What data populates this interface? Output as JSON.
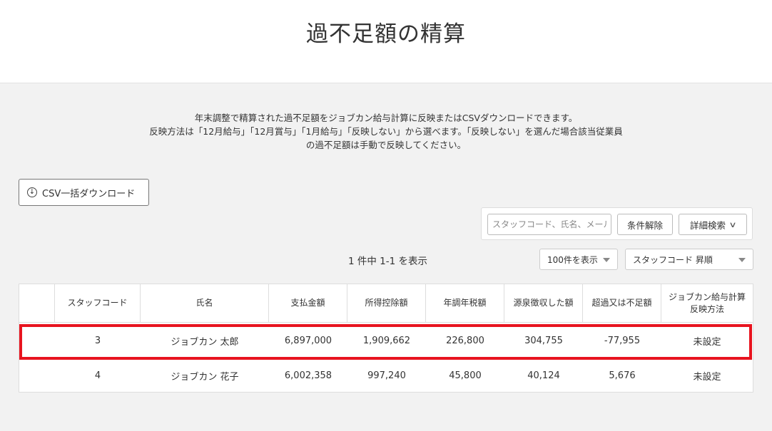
{
  "page": {
    "title": "過不足額の精算"
  },
  "description": {
    "line1": "年末調整で精算された過不足額をジョブカン給与計算に反映またはCSVダウンロードできます。",
    "line2": "反映方法は「12月給与」「12月賞与」「1月給与」「反映しない」から選べます。「反映しない」を選んだ場合該当従業員",
    "line3": "の過不足額は手動で反映してください。"
  },
  "toolbar": {
    "csv_download_label": "CSV一括ダウンロード",
    "csv_icon": "download-circle-icon"
  },
  "search": {
    "placeholder": "スタッフコード、氏名、メール",
    "clear_label": "条件解除",
    "advanced_label": "詳細検索",
    "advanced_icon": "chevron-down-icon"
  },
  "listing": {
    "count_text": "1 件中 1-1 を表示",
    "per_page": "100件を表示",
    "sort": "スタッフコード 昇順"
  },
  "table": {
    "headers": [
      "",
      "スタッフコード",
      "氏名",
      "支払金額",
      "所得控除額",
      "年調年税額",
      "源泉徴収した額",
      "超過又は不足額",
      "ジョブカン給与計算\n反映方法"
    ],
    "rows": [
      [
        "",
        "3",
        "ジョブカン 太郎",
        "6,897,000",
        "1,909,662",
        "226,800",
        "304,755",
        "-77,955",
        "未設定"
      ],
      [
        "",
        "4",
        "ジョブカン 花子",
        "6,002,358",
        "997,240",
        "45,800",
        "40,124",
        "5,676",
        "未設定"
      ]
    ]
  },
  "colors": {
    "highlight": "#e8141f",
    "background": "#f2f2f2"
  }
}
